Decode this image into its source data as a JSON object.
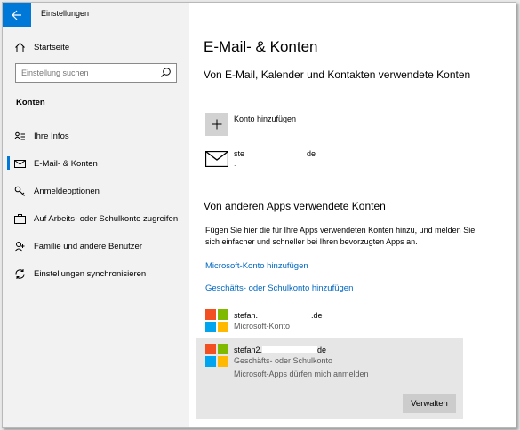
{
  "window": {
    "title": "Einstellungen"
  },
  "sidebar": {
    "home": {
      "label": "Startseite",
      "icon": "home-icon"
    },
    "search": {
      "placeholder": "Einstellung suchen",
      "icon": "search-icon"
    },
    "section": "Konten",
    "items": [
      {
        "label": "Ihre Infos",
        "icon": "person-card-icon"
      },
      {
        "label": "E-Mail- & Konten",
        "icon": "mail-icon",
        "active": true
      },
      {
        "label": "Anmeldeoptionen",
        "icon": "key-icon"
      },
      {
        "label": "Auf Arbeits- oder Schulkonto zugreifen",
        "icon": "briefcase-icon"
      },
      {
        "label": "Familie und andere Benutzer",
        "icon": "person-add-icon"
      },
      {
        "label": "Einstellungen synchronisieren",
        "icon": "sync-icon"
      }
    ]
  },
  "main": {
    "title": "E-Mail- & Konten",
    "section1_heading": "Von E-Mail, Kalender und Kontakten verwendete Konten",
    "add_account_label": "Konto hinzufügen",
    "email_account": {
      "prefix": "ste",
      "suffix": "de",
      "line2": "."
    },
    "section2_heading": "Von anderen Apps verwendete Konten",
    "section2_text": "Fügen Sie hier die für Ihre Apps verwendeten Konten hinzu, und melden Sie sich einfacher und schneller bei Ihren bevorzugten Apps an.",
    "link_ms": "Microsoft-Konto hinzufügen",
    "link_work": "Geschäfts- oder Schulkonto hinzufügen",
    "accounts": [
      {
        "prefix": "stefan.",
        "suffix": ".de",
        "type": "Microsoft-Konto"
      },
      {
        "prefix": "stefan2.",
        "suffix": "de",
        "type": "Geschäfts- oder Schulkonto",
        "note": "Microsoft-Apps dürfen mich anmelden",
        "button": "Verwalten"
      }
    ]
  },
  "colors": {
    "accent": "#0078d7",
    "link": "#0067c0",
    "ms_red": "#f25022",
    "ms_green": "#7fba00",
    "ms_blue": "#00a4ef",
    "ms_yellow": "#ffb900"
  }
}
